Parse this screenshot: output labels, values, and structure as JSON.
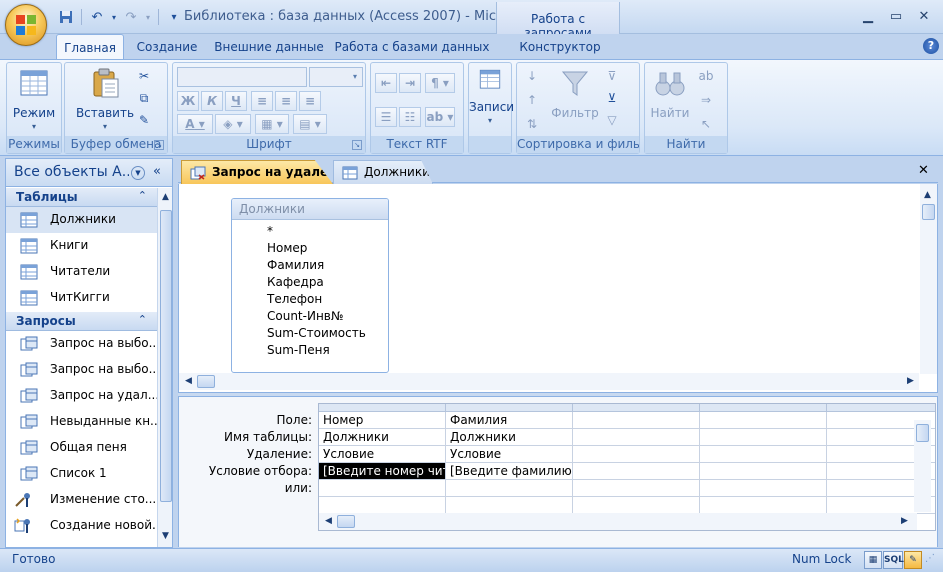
{
  "window": {
    "title": "Библиотека : база данных (Access 2007) - Mic...",
    "context_tab_header": "Работа с запросами"
  },
  "ribbon": {
    "tabs": [
      {
        "label": "Главная",
        "active": true
      },
      {
        "label": "Создание",
        "active": false
      },
      {
        "label": "Внешние данные",
        "active": false
      },
      {
        "label": "Работа с базами данных",
        "active": false
      },
      {
        "label": "Конструктор",
        "active": false
      }
    ],
    "groups": {
      "modes": {
        "label": "Режимы",
        "view_button": "Режим"
      },
      "clipboard": {
        "label": "Буфер обмена",
        "paste_button": "Вставить"
      },
      "font": {
        "label": "Шрифт",
        "bold": "Ж",
        "italic": "К",
        "underline": "Ч",
        "font_color_glyph": "A"
      },
      "rich_text": {
        "label": "Текст RTF"
      },
      "records": {
        "label": "",
        "records_button": "Записи"
      },
      "sort_filter": {
        "label": "Сортировка и фильтр",
        "filter_button": "Фильтр"
      },
      "find": {
        "label": "Найти",
        "find_button": "Найти"
      }
    }
  },
  "nav_pane": {
    "title": "Все объекты А...",
    "groups": [
      {
        "label": "Таблицы",
        "items": [
          {
            "label": "Должники",
            "selected": true
          },
          {
            "label": "Книги",
            "selected": false
          },
          {
            "label": "Читатели",
            "selected": false
          },
          {
            "label": "ЧитКигги",
            "selected": false
          }
        ]
      },
      {
        "label": "Запросы",
        "items": [
          {
            "label": "Запрос на выбо...",
            "kind": "select"
          },
          {
            "label": "Запрос на выбо...",
            "kind": "select"
          },
          {
            "label": "Запрос на удал...",
            "kind": "select"
          },
          {
            "label": "Невыданные кн...",
            "kind": "select"
          },
          {
            "label": "Общая пеня",
            "kind": "select"
          },
          {
            "label": "Список 1",
            "kind": "select"
          },
          {
            "label": "Изменение сто...",
            "kind": "update"
          },
          {
            "label": "Создание новой...",
            "kind": "make"
          }
        ]
      }
    ]
  },
  "doc_tabs": [
    {
      "label": "Запрос на удаление",
      "active": true
    },
    {
      "label": "Должники",
      "active": false
    }
  ],
  "field_list": {
    "title": "Должники",
    "fields": [
      "*",
      "Номер",
      "Фамилия",
      "Кафедра",
      "Телефон",
      "Count-Инв№",
      "Sum-Стоимость",
      "Sum-Пеня"
    ]
  },
  "qbe_grid": {
    "row_labels": [
      "Поле:",
      "Имя таблицы:",
      "Удаление:",
      "Условие отбора:",
      "или:"
    ],
    "columns": [
      {
        "field": "Номер",
        "table": "Должники",
        "delete": "Условие",
        "criteria": "[Введите номер читателя]",
        "or": ""
      },
      {
        "field": "Фамилия",
        "table": "Должники",
        "delete": "Условие",
        "criteria": "[Введите фамилию должника]",
        "or": ""
      },
      {
        "field": "",
        "table": "",
        "delete": "",
        "criteria": "",
        "or": ""
      },
      {
        "field": "",
        "table": "",
        "delete": "",
        "criteria": "",
        "or": ""
      },
      {
        "field": "",
        "table": "",
        "delete": "",
        "criteria": "",
        "or": ""
      }
    ]
  },
  "status": {
    "left": "Готово",
    "num_lock": "Num Lock",
    "sql_label": "SQL"
  },
  "colors": {
    "ribbon_text": "#15428b",
    "active_tab": "#f8c65a",
    "frame": "#bfd3ee"
  }
}
